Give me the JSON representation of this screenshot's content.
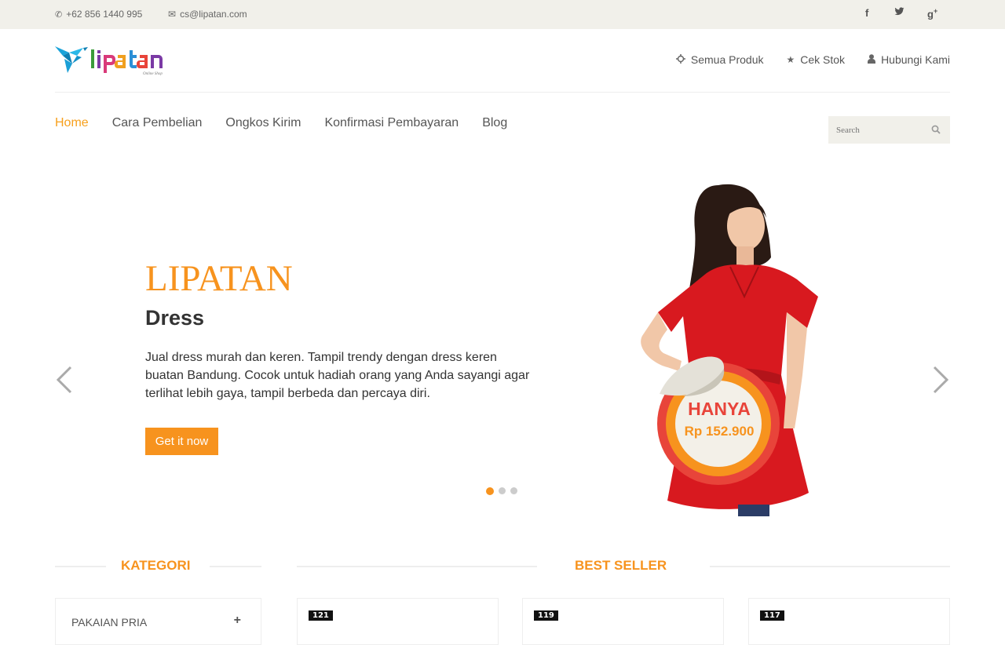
{
  "topbar": {
    "phone": "+62 856 1440 995",
    "email": "cs@lipatan.com",
    "social": [
      "facebook-icon",
      "twitter-icon",
      "google-plus-icon"
    ]
  },
  "header": {
    "logo_text": "lipatan",
    "logo_tagline": "Online Shop",
    "links": [
      {
        "label": "Semua Produk",
        "icon": "crosshair-icon"
      },
      {
        "label": "Cek Stok",
        "icon": "star-icon"
      },
      {
        "label": "Hubungi Kami",
        "icon": "user-icon"
      }
    ]
  },
  "nav": {
    "items": [
      "Home",
      "Cara Pembelian",
      "Ongkos Kirim",
      "Konfirmasi Pembayaran",
      "Blog"
    ],
    "active": "Home"
  },
  "search": {
    "placeholder": "Search"
  },
  "slider": {
    "title": "LIPATAN",
    "subtitle": "Dress",
    "description": "Jual dress murah dan keren. Tampil trendy dengan dress keren buatan Bandung. Cocok untuk hadiah orang yang Anda sayangi agar terlihat lebih gaya, tampil berbeda dan percaya diri.",
    "cta_label": "Get it now",
    "badge_line1": "HANYA",
    "badge_line2": "Rp 152.900",
    "slides_count": 3,
    "active_slide": 1
  },
  "sections": {
    "kategori": "KATEGORI",
    "best_seller": "BEST SELLER"
  },
  "categories": [
    "PAKAIAN PRIA"
  ],
  "products": [
    {
      "badge": "121"
    },
    {
      "badge": "119"
    },
    {
      "badge": "117"
    }
  ],
  "colors": {
    "accent": "#f7931e",
    "topbar_bg": "#f1f0ea",
    "badge_red": "#e8443a"
  }
}
